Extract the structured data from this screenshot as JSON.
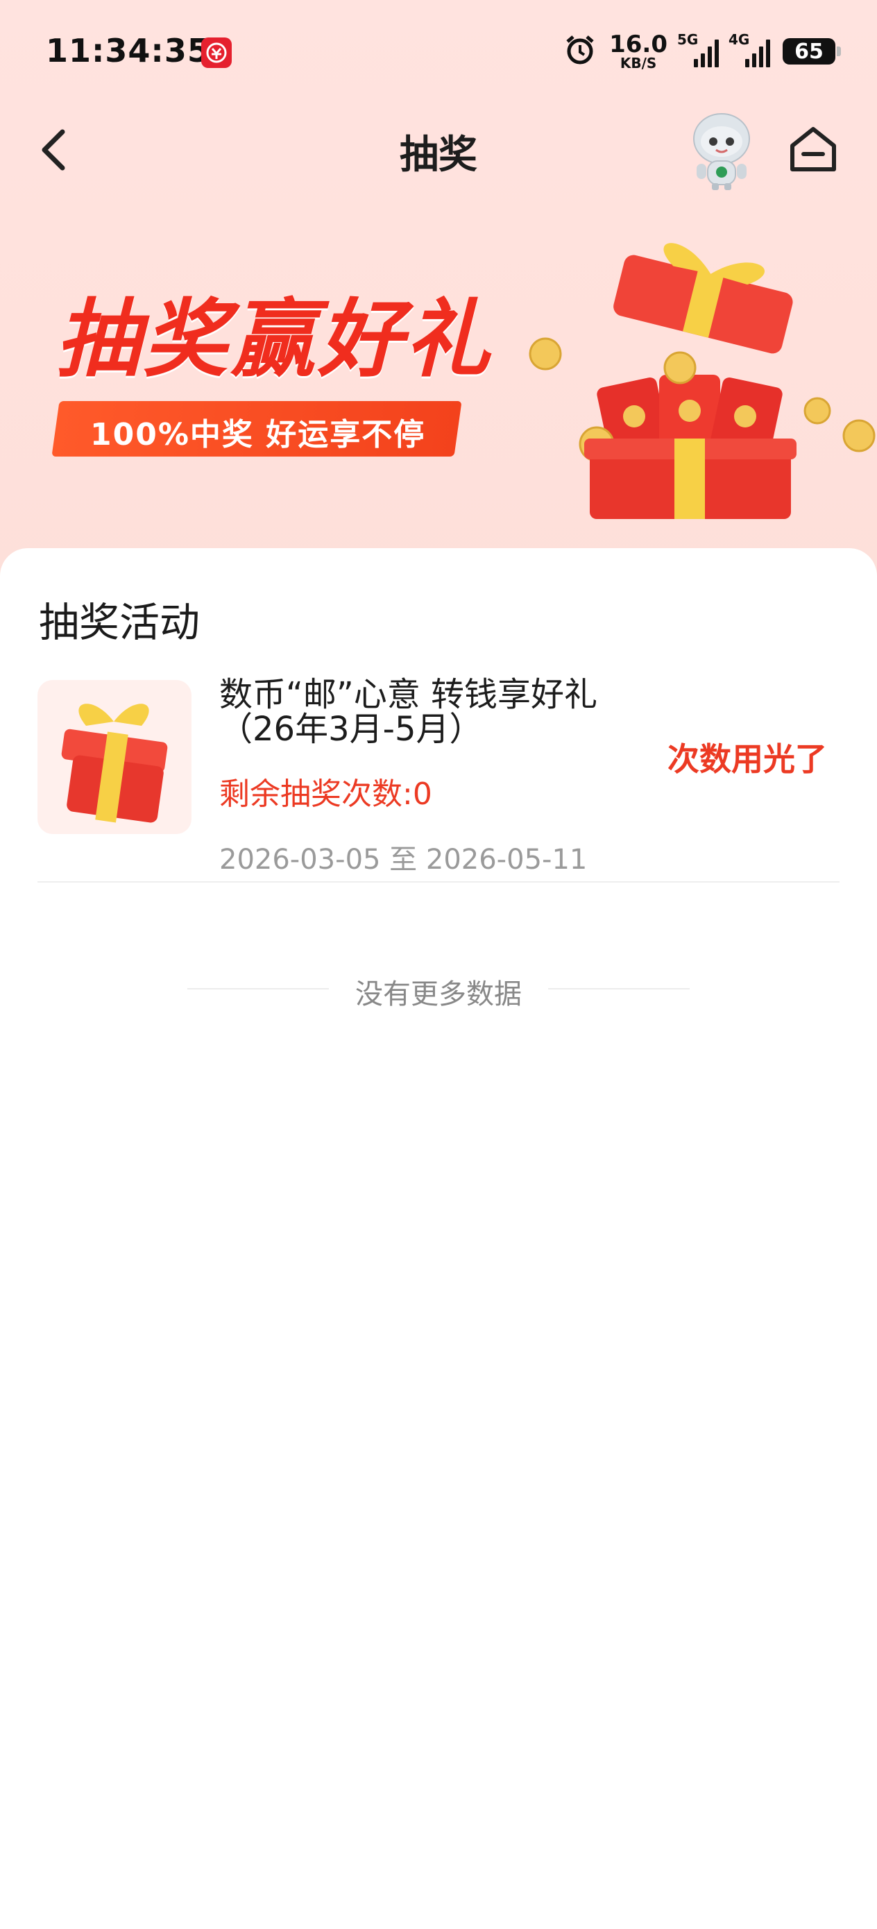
{
  "status_bar": {
    "time": "11:34:35",
    "net_speed": "16.0",
    "net_unit": "KB/S",
    "signal_1": "5G",
    "signal_2": "4G",
    "battery": "65"
  },
  "nav": {
    "title": "抽奖"
  },
  "banner": {
    "title": "抽奖赢好礼",
    "subtitle": "100%中奖  好运享不停"
  },
  "section": {
    "title": "抽奖活动"
  },
  "activities": [
    {
      "name_line1": "数币“邮”心意 转钱享好礼",
      "name_line2": "（26年3月-5月）",
      "remaining": "剩余抽奖次数:0",
      "date_range": "2026-03-05 至 2026-05-11",
      "status": "次数用光了"
    }
  ],
  "list_footer": "没有更多数据",
  "colors": {
    "accent_red": "#ec3a23",
    "banner_bg": "#ffe3df"
  }
}
